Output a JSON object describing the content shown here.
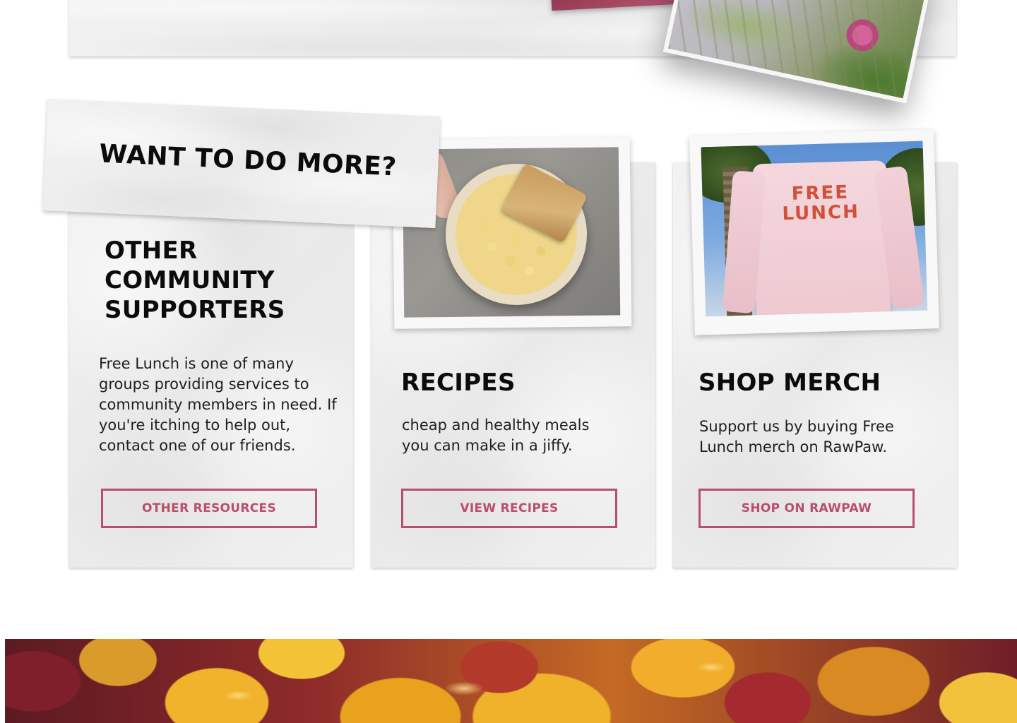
{
  "label": {
    "text": "WANT TO DO MORE?"
  },
  "cards": [
    {
      "heading": "OTHER COMMUNITY SUPPORTERS",
      "body": "Free Lunch is one of many groups providing services to community members in need. If you're itching to help out, contact one of our friends.",
      "button": "OTHER RESOURCES"
    },
    {
      "heading": "RECIPES",
      "body": "cheap and healthy meals you can make in a jiffy.",
      "button": "VIEW RECIPES",
      "image": "mac-and-cheese-bowl"
    },
    {
      "heading": "SHOP MERCH",
      "body": "Support us by buying Free Lunch merch on RawPaw.",
      "button": "SHOP ON RAWPAW",
      "image": "free-lunch-shirt",
      "shirt_text": "FREE LUNCH"
    }
  ],
  "colors": {
    "accent": "#b84f6c",
    "paper": "#efeeee",
    "heading": "#0b0b0b"
  }
}
